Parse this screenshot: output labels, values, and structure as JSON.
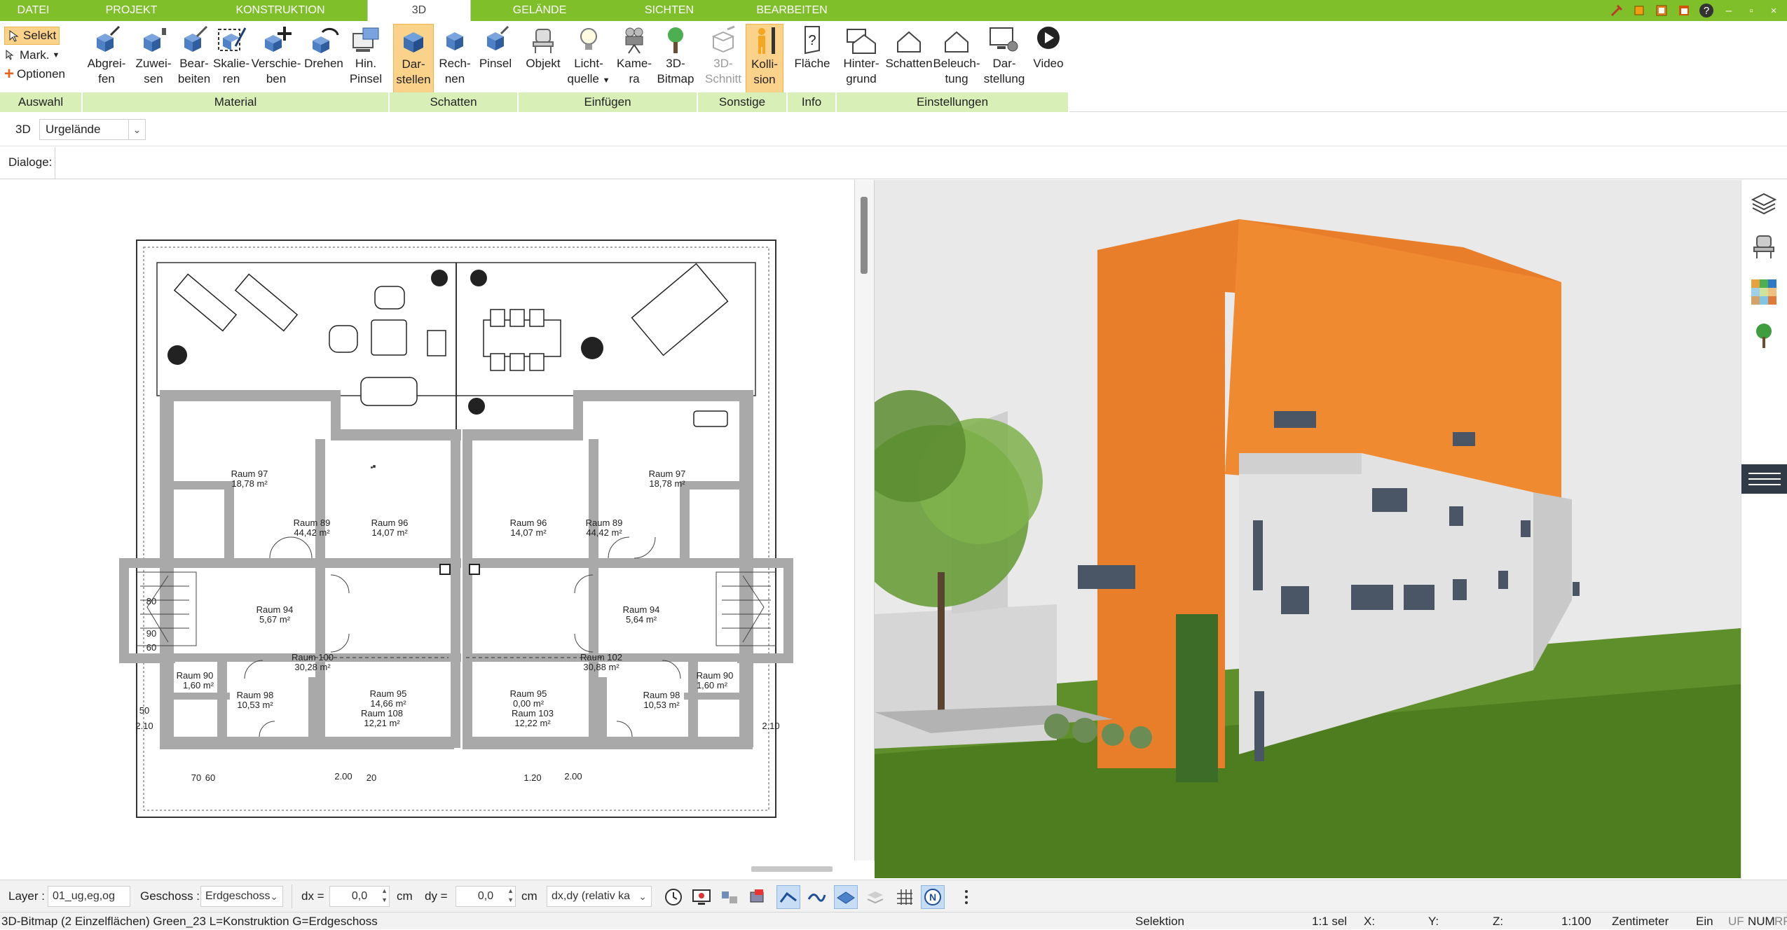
{
  "tabs": [
    {
      "label": "DATEI",
      "active": false
    },
    {
      "label": "PROJEKT",
      "active": false
    },
    {
      "label": "KONSTRUKTION",
      "active": false
    },
    {
      "label": "3D",
      "active": true
    },
    {
      "label": "GELÄNDE",
      "active": false
    },
    {
      "label": "SICHTEN",
      "active": false
    },
    {
      "label": "BEARBEITEN",
      "active": false
    }
  ],
  "ribbon": {
    "selection": {
      "selekt": "Selekt",
      "mark": "Mark.",
      "optionen": "Optionen",
      "group": "Auswahl"
    },
    "material": {
      "group": "Material",
      "buttons": [
        {
          "l1": "Abgrei-",
          "l2": "fen"
        },
        {
          "l1": "Zuwei-",
          "l2": "sen"
        },
        {
          "l1": "Bear-",
          "l2": "beiten"
        },
        {
          "l1": "Skalie-",
          "l2": "ren"
        },
        {
          "l1": "Verschie-",
          "l2": "ben"
        },
        {
          "l1": "Drehen",
          "l2": ""
        },
        {
          "l1": "Hin.",
          "l2": "Pinsel"
        }
      ]
    },
    "schatten": {
      "group": "Schatten",
      "buttons": [
        {
          "l1": "Dar-",
          "l2": "stellen"
        },
        {
          "l1": "Rech-",
          "l2": "nen"
        },
        {
          "l1": "Pinsel",
          "l2": ""
        }
      ]
    },
    "einfuegen": {
      "group": "Einfügen",
      "buttons": [
        {
          "l1": "Objekt",
          "l2": ""
        },
        {
          "l1": "Licht-",
          "l2": "quelle"
        },
        {
          "l1": "Kame-",
          "l2": "ra"
        },
        {
          "l1": "3D-",
          "l2": "Bitmap"
        }
      ]
    },
    "sonstige": {
      "group": "Sonstige",
      "buttons": [
        {
          "l1": "3D-",
          "l2": "Schnitt"
        },
        {
          "l1": "Kolli-",
          "l2": "sion"
        }
      ]
    },
    "info": {
      "group": "Info",
      "buttons": [
        {
          "l1": "Fläche",
          "l2": ""
        }
      ]
    },
    "einstellungen": {
      "group": "Einstellungen",
      "buttons": [
        {
          "l1": "Hinter-",
          "l2": "grund"
        },
        {
          "l1": "Schatten",
          "l2": ""
        },
        {
          "l1": "Beleuch-",
          "l2": "tung"
        },
        {
          "l1": "Dar-",
          "l2": "stellung"
        },
        {
          "l1": "Video",
          "l2": ""
        }
      ]
    }
  },
  "bar3d": {
    "label": "3D",
    "dropdown_value": "Urgelände"
  },
  "dialog": {
    "label": "Dialoge:"
  },
  "plan": {
    "rooms": [
      {
        "id": "r97l",
        "name": "Raum 97",
        "area": "18,78 m²"
      },
      {
        "id": "r89l",
        "name": "Raum 89",
        "area": "44,42 m²"
      },
      {
        "id": "r96l",
        "name": "Raum 96",
        "area": "14,07 m²"
      },
      {
        "id": "r96r",
        "name": "Raum 96",
        "area": "14,07 m²"
      },
      {
        "id": "r89r",
        "name": "Raum 89",
        "area": "44,42 m²"
      },
      {
        "id": "r97r",
        "name": "Raum 97",
        "area": "18,78 m²"
      },
      {
        "id": "r94l",
        "name": "Raum 94",
        "area": "5,67 m²"
      },
      {
        "id": "r94r",
        "name": "Raum 94",
        "area": "5,64 m²"
      },
      {
        "id": "r100",
        "name": "Raum 100",
        "area": "30,28 m²"
      },
      {
        "id": "r102",
        "name": "Raum 102",
        "area": "30,88 m²"
      },
      {
        "id": "r95l",
        "name": "Raum 95",
        "area": "14,66 m²"
      },
      {
        "id": "r108",
        "name": "Raum 108",
        "area": "12,21 m²"
      },
      {
        "id": "r95r",
        "name": "Raum 95",
        "area": "0,00 m²"
      },
      {
        "id": "r103",
        "name": "Raum 103",
        "area": "12,22 m²"
      },
      {
        "id": "r90l",
        "name": "Raum 90",
        "area": "1,60 m²"
      },
      {
        "id": "r90r",
        "name": "Raum 90",
        "area": "1,60 m²"
      },
      {
        "id": "r98l",
        "name": "Raum 98",
        "area": "10,53 m²"
      },
      {
        "id": "r98r",
        "name": "Raum 98",
        "area": "10,53 m²"
      }
    ],
    "dims": [
      "80",
      "2.00",
      "2.10",
      "90",
      "60",
      "2.00",
      "2.10",
      "70",
      "60",
      "20",
      "50",
      "1.20"
    ]
  },
  "bottombar": {
    "layer_label": "Layer :",
    "layer_value": "01_ug,eg,og",
    "geschoss_label": "Geschoss :",
    "geschoss_value": "Erdgeschoss",
    "dx_label": "dx =",
    "dx_value": "0,0",
    "dx_unit": "cm",
    "dy_label": "dy =",
    "dy_value": "0,0",
    "dy_unit": "cm",
    "mode_value": "dx,dy (relativ ka"
  },
  "statusbar": {
    "info": "3D-Bitmap (2 Einzelflächen) Green_23 L=Konstruktion G=Erdgeschoss",
    "mode": "Selektion",
    "scale_sel": "1:1 sel",
    "x": "X:",
    "y": "Y:",
    "z": "Z:",
    "scale": "1:100",
    "unit": "Zentimeter",
    "ein": "Ein",
    "uf": "UF",
    "num": "NUM",
    "rf": "RF"
  }
}
